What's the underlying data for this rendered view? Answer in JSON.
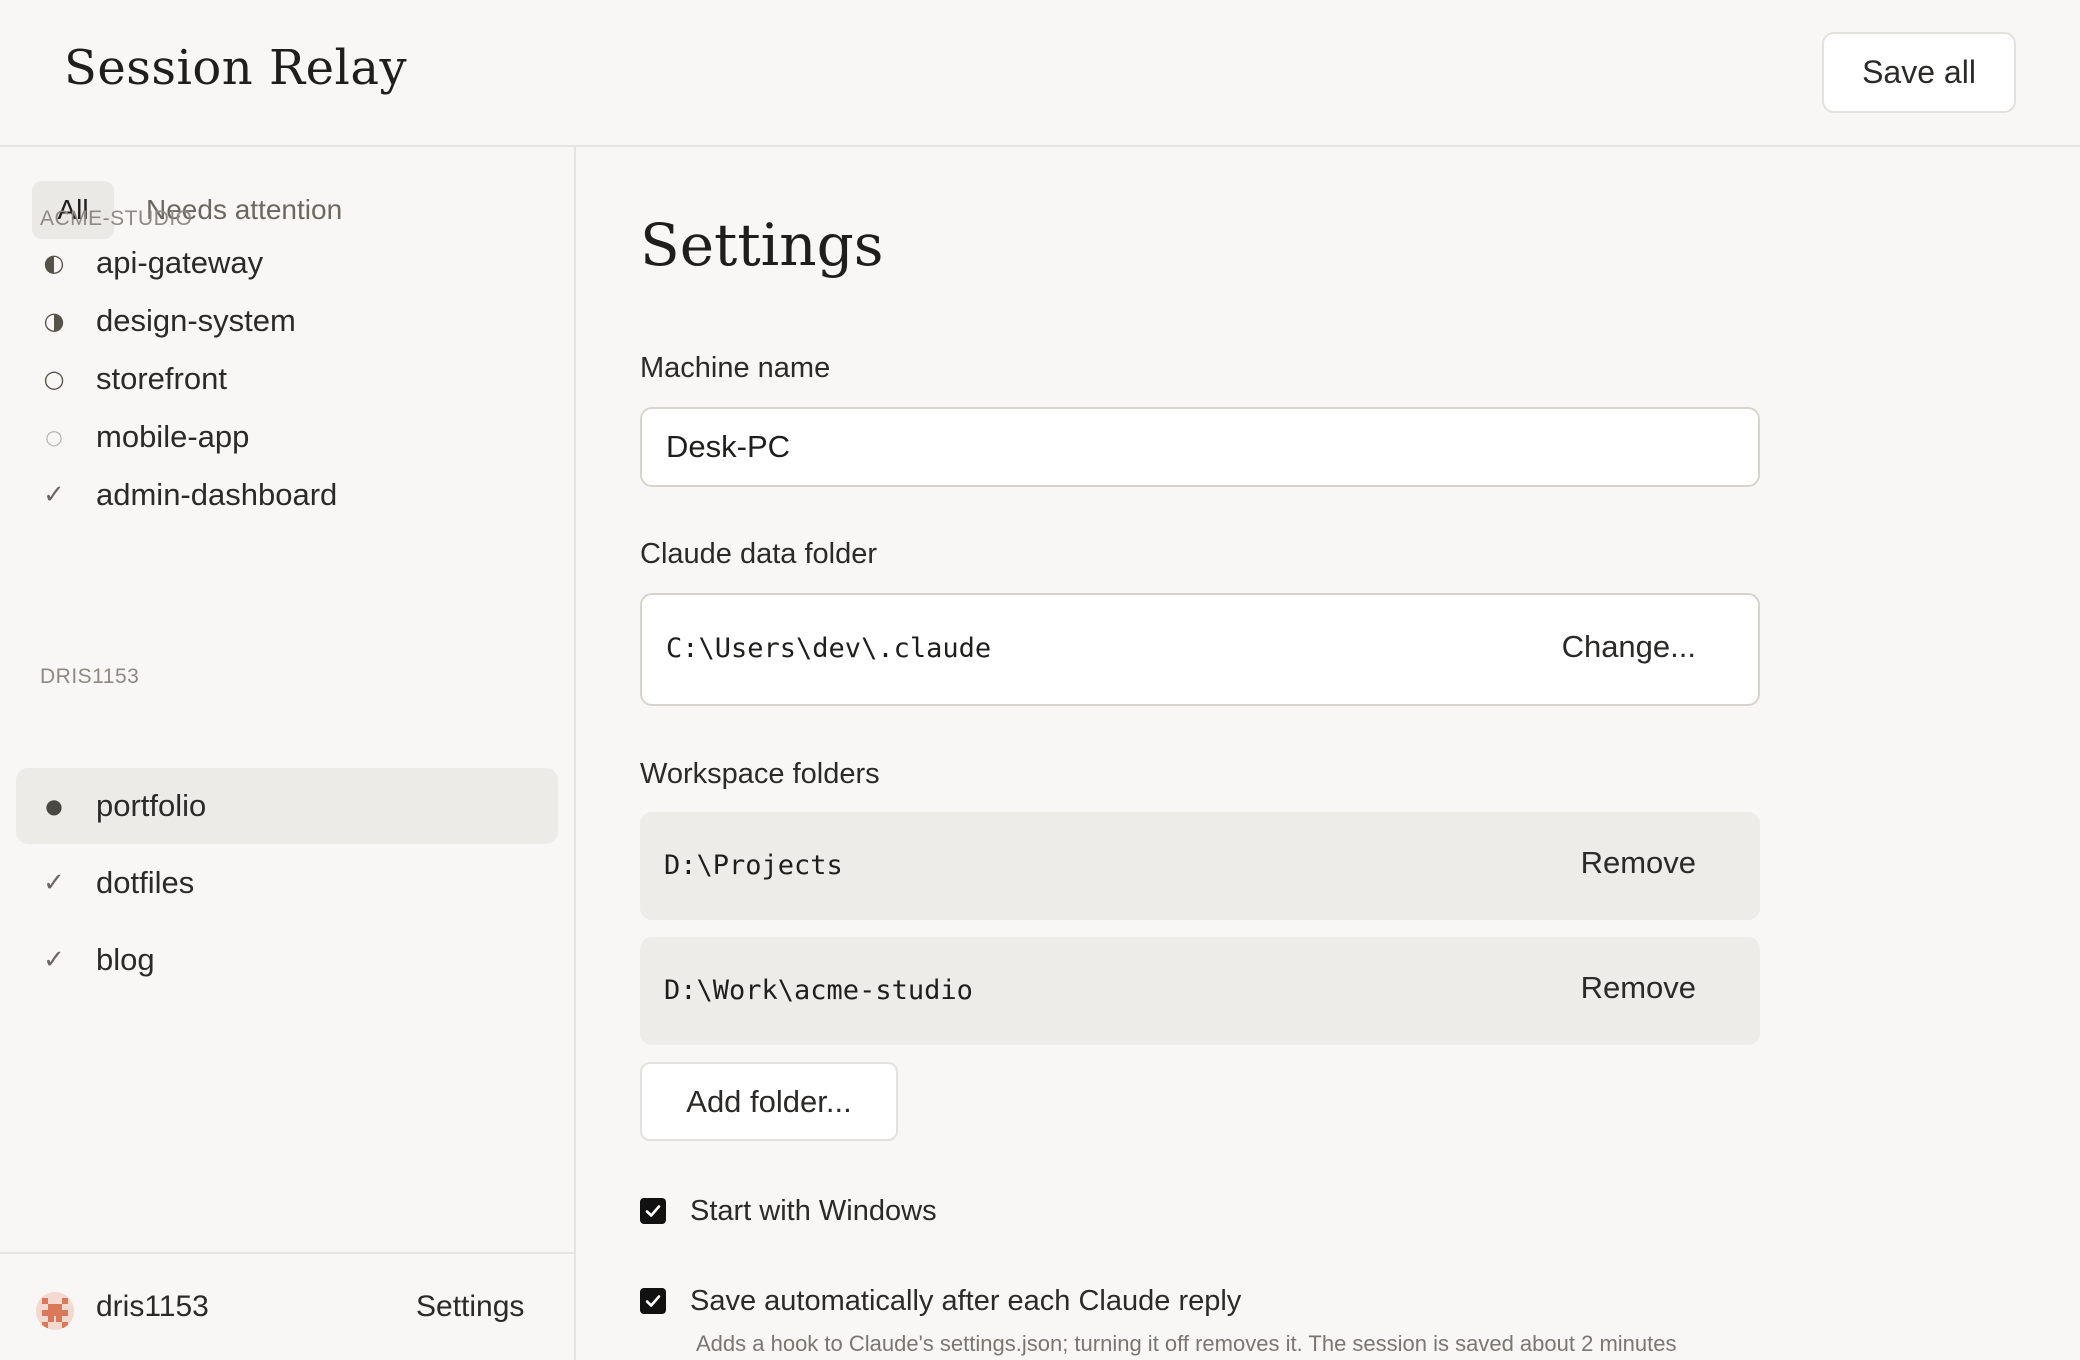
{
  "app": {
    "title": "Session Relay",
    "save_all_label": "Save all"
  },
  "sidebar": {
    "filters": {
      "all": "All",
      "needs_attention": "Needs attention"
    },
    "groups": [
      {
        "label": "ACME-STUDIO",
        "projects": [
          {
            "name": "api-gateway",
            "status_icon": "half-circle-left-icon",
            "glyph": "◐"
          },
          {
            "name": "design-system",
            "status_icon": "half-circle-right-icon",
            "glyph": "◑"
          },
          {
            "name": "storefront",
            "status_icon": "empty-circle-icon",
            "glyph": "○"
          },
          {
            "name": "mobile-app",
            "status_icon": "faint-circle-icon",
            "glyph": "○"
          },
          {
            "name": "admin-dashboard",
            "status_icon": "check-icon",
            "glyph": "✓"
          }
        ]
      },
      {
        "label": "DRIS1153",
        "projects": [
          {
            "name": "portfolio",
            "status_icon": "dot-icon",
            "glyph": "●",
            "active": true
          },
          {
            "name": "dotfiles",
            "status_icon": "check-icon",
            "glyph": "✓"
          },
          {
            "name": "blog",
            "status_icon": "check-icon",
            "glyph": "✓"
          }
        ]
      }
    ],
    "footer": {
      "username": "dris1153",
      "settings_label": "Settings"
    }
  },
  "settings": {
    "title": "Settings",
    "machine_name": {
      "label": "Machine name",
      "value": "Desk-PC"
    },
    "claude_data_folder": {
      "label": "Claude data folder",
      "path": "C:\\Users\\dev\\.claude",
      "change_label": "Change..."
    },
    "workspace_folders": {
      "label": "Workspace folders",
      "items": [
        {
          "path": "D:\\Projects",
          "remove_label": "Remove"
        },
        {
          "path": "D:\\Work\\acme-studio",
          "remove_label": "Remove"
        }
      ],
      "add_label": "Add folder..."
    },
    "start_with_windows": {
      "label": "Start with Windows",
      "checked": true
    },
    "auto_save": {
      "label": "Save automatically after each Claude reply",
      "checked": true,
      "help": "Adds a hook to Claude's settings.json; turning it off removes it. The session is saved about 2 minutes"
    }
  },
  "colors": {
    "accent": "#111111",
    "background": "#f8f7f5",
    "active_row": "#ecebe8",
    "avatar": "#d9795a"
  }
}
